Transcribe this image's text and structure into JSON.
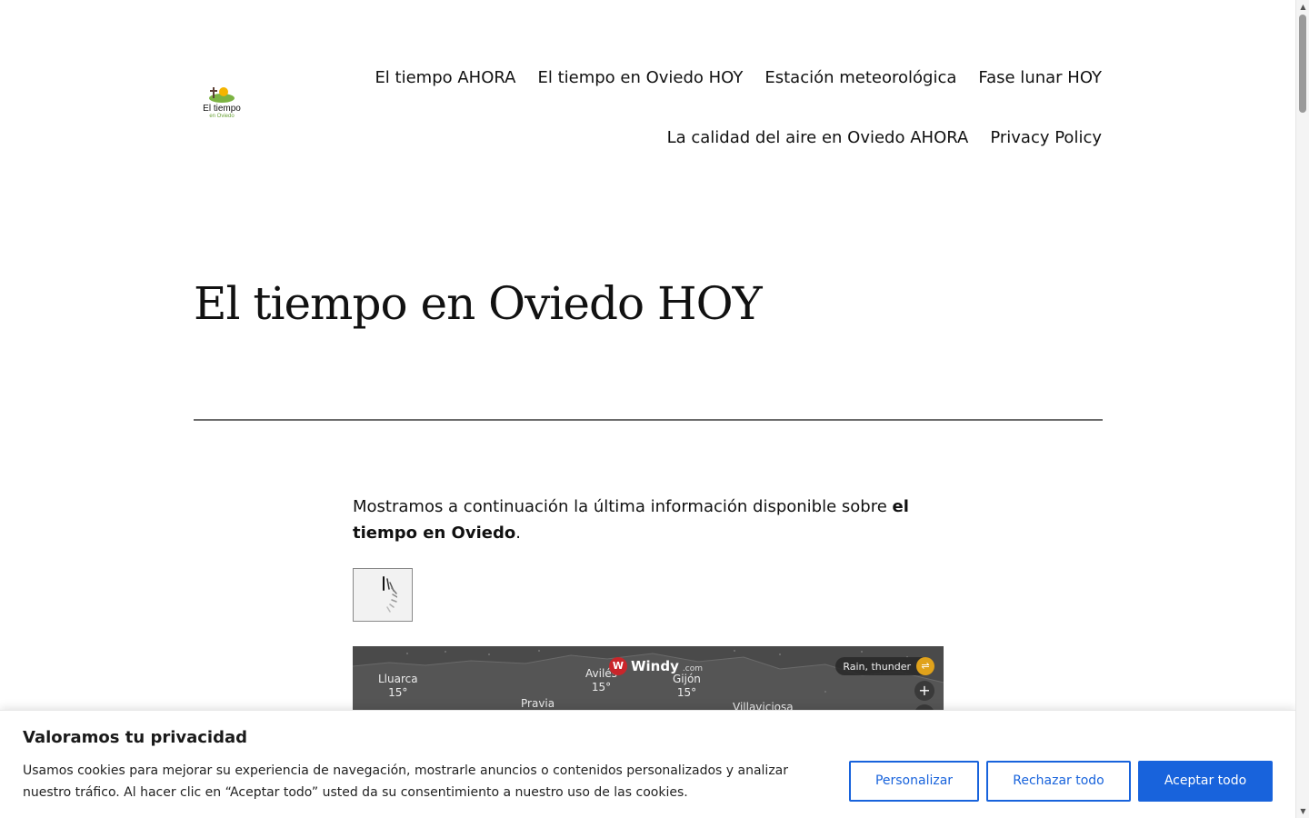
{
  "site": {
    "logo_title": "El tiempo",
    "logo_subtitle": "en Oviedo"
  },
  "nav": {
    "row1": [
      "El tiempo AHORA",
      "El tiempo en Oviedo HOY",
      "Estación meteorológica",
      "Fase lunar HOY"
    ],
    "row2": [
      "La calidad del aire en Oviedo AHORA",
      "Privacy Policy"
    ]
  },
  "page": {
    "title": "El tiempo en Oviedo HOY",
    "intro_prefix": "Mostramos a continuación la última información disponible sobre ",
    "intro_bold": "el tiempo en Oviedo",
    "intro_suffix": "."
  },
  "map": {
    "brand": "Windy",
    "brand_suffix": ".com",
    "layer_label": "Rain, thunder",
    "zoom_in_label": "+",
    "cities": [
      {
        "name": "Lluarca",
        "temp": "15°"
      },
      {
        "name": "Avilés",
        "temp": "15°"
      },
      {
        "name": "Gijón",
        "temp": "15°"
      },
      {
        "name": "Pravia",
        "temp": ""
      },
      {
        "name": "Villaviciosa",
        "temp": ""
      }
    ]
  },
  "cookie": {
    "title": "Valoramos tu privacidad",
    "text": "Usamos cookies para mejorar su experiencia de navegación, mostrarle anuncios o contenidos personalizados y analizar nuestro tráfico. Al hacer clic en “Aceptar todo” usted da su consentimiento a nuestro uso de las cookies.",
    "customize": "Personalizar",
    "reject": "Rechazar todo",
    "accept": "Aceptar todo"
  },
  "colors": {
    "accent": "#1863dc",
    "map_bg": "#555555",
    "windy_red": "#c9262b",
    "layer_yellow": "#e0a21b"
  }
}
